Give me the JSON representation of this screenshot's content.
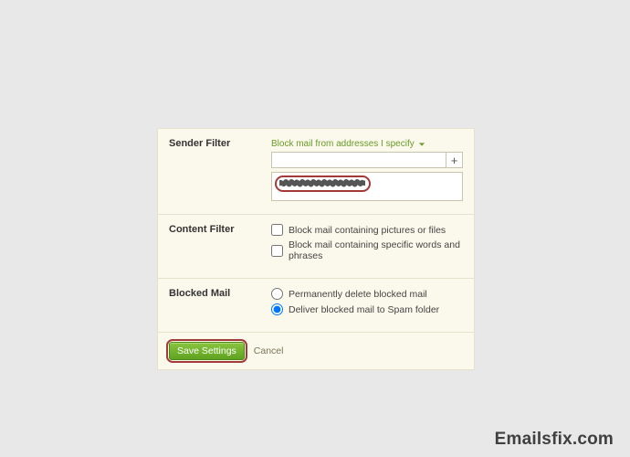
{
  "senderFilter": {
    "label": "Sender Filter",
    "dropdown": "Block mail from addresses I specify",
    "inputValue": "",
    "plus": "+"
  },
  "contentFilter": {
    "label": "Content Filter",
    "opt1": "Block mail containing pictures or files",
    "opt2": "Block mail containing specific words and phrases"
  },
  "blockedMail": {
    "label": "Blocked Mail",
    "opt1": "Permanently delete blocked mail",
    "opt2": "Deliver blocked mail to Spam folder"
  },
  "actions": {
    "save": "Save Settings",
    "cancel": "Cancel"
  },
  "watermark": "Emailsfix.com"
}
